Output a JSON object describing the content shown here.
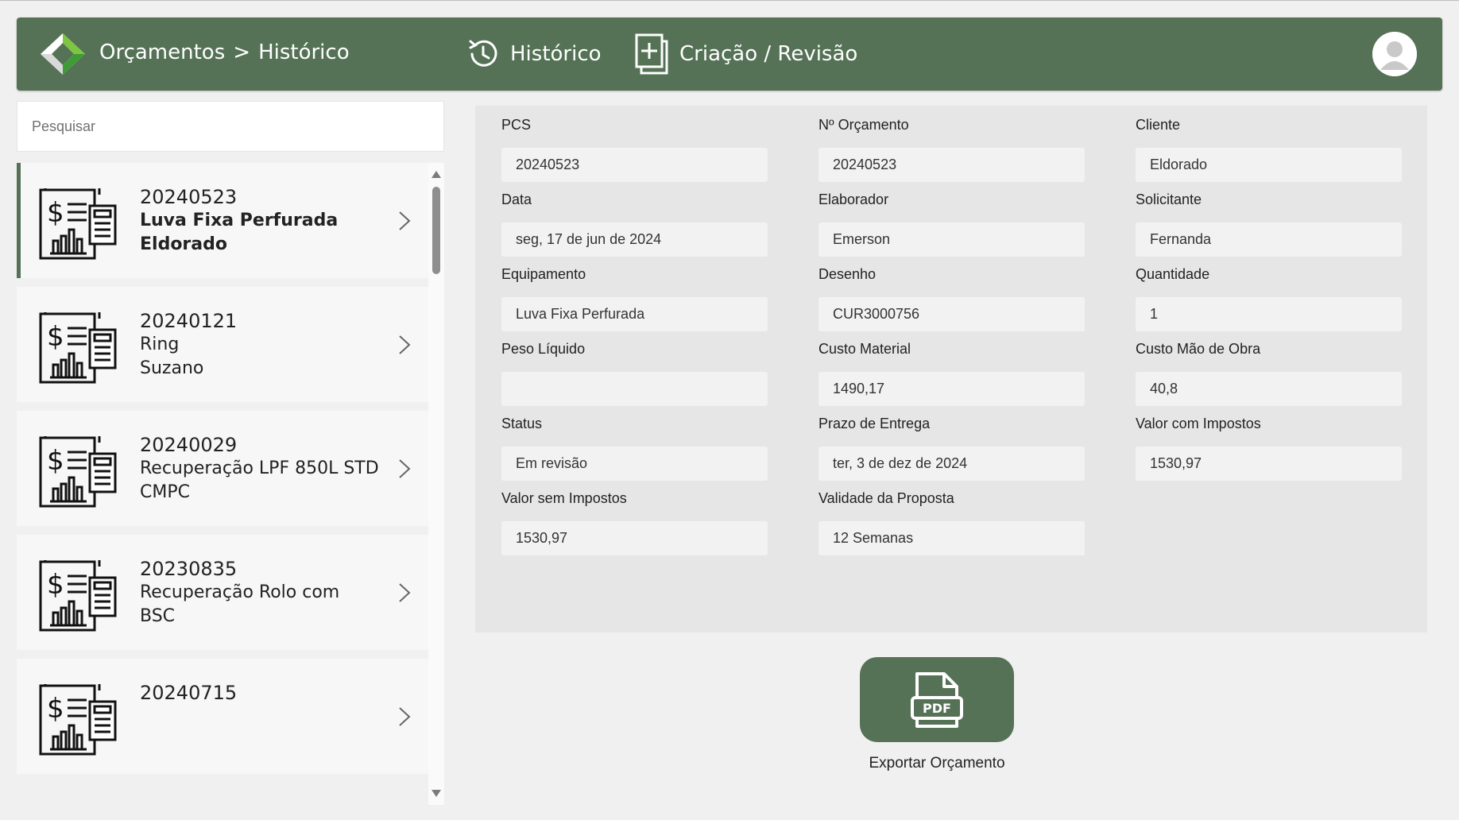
{
  "header": {
    "breadcrumb": [
      "Orçamentos",
      ">",
      "Histórico"
    ],
    "nav": [
      {
        "label": "Histórico",
        "icon": "history-icon"
      },
      {
        "label": "Criação / Revisão",
        "icon": "add-document-icon"
      }
    ],
    "avatar_icon": "user-avatar-icon",
    "color": "#557256"
  },
  "search": {
    "placeholder": "Pesquisar"
  },
  "list": {
    "items": [
      {
        "number": "20240523",
        "equipment": "Luva Fixa Perfurada",
        "client": "Eldorado",
        "selected": true
      },
      {
        "number": "20240121",
        "equipment": "Ring",
        "client": "Suzano",
        "selected": false
      },
      {
        "number": "20240029",
        "equipment": "Recuperação LPF 850L STD",
        "client": "CMPC",
        "selected": false
      },
      {
        "number": "20230835",
        "equipment": "Recuperação Rolo com",
        "client": "BSC",
        "selected": false
      },
      {
        "number": "20240715",
        "equipment": "",
        "client": "",
        "selected": false
      }
    ]
  },
  "detail": {
    "fields": [
      {
        "label": "PCS",
        "value": "20240523"
      },
      {
        "label": "Nº Orçamento",
        "value": "20240523"
      },
      {
        "label": "Cliente",
        "value": "Eldorado"
      },
      {
        "label": "Data",
        "value": "seg, 17 de jun de 2024"
      },
      {
        "label": "Elaborador",
        "value": "Emerson"
      },
      {
        "label": "Solicitante",
        "value": "Fernanda"
      },
      {
        "label": "Equipamento",
        "value": "Luva Fixa Perfurada"
      },
      {
        "label": "Desenho",
        "value": "CUR3000756"
      },
      {
        "label": "Quantidade",
        "value": "1"
      },
      {
        "label": "Peso Líquido",
        "value": ""
      },
      {
        "label": "Custo Material",
        "value": "1490,17"
      },
      {
        "label": "Custo Mão de Obra",
        "value": "40,8"
      },
      {
        "label": "Status",
        "value": "Em revisão"
      },
      {
        "label": "Prazo de Entrega",
        "value": "ter, 3 de dez de 2024"
      },
      {
        "label": "Valor com Impostos",
        "value": "1530,97"
      },
      {
        "label": "Valor sem Impostos",
        "value": "1530,97"
      },
      {
        "label": "Validade da Proposta",
        "value": "12 Semanas"
      }
    ]
  },
  "export": {
    "label": "Exportar Orçamento",
    "icon": "pdf-icon"
  }
}
